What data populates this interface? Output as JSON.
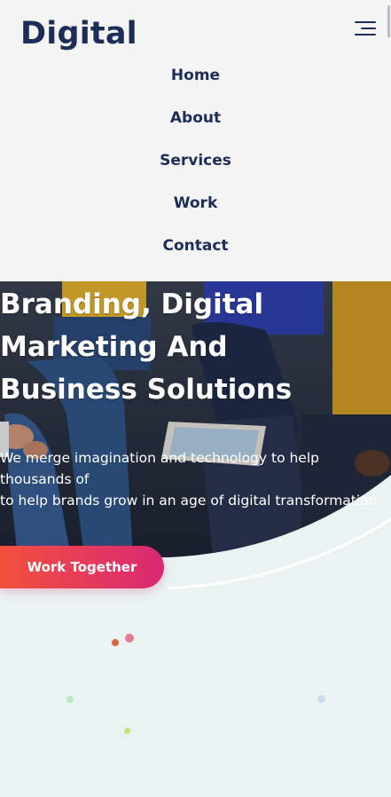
{
  "header": {
    "logo": "Digital",
    "menu_icon": "hamburger-menu-icon"
  },
  "nav": {
    "items": [
      {
        "label": "Home"
      },
      {
        "label": "About"
      },
      {
        "label": "Services"
      },
      {
        "label": "Work"
      },
      {
        "label": "Contact"
      }
    ]
  },
  "hero": {
    "title_lines": [
      "Branding, Digital",
      "Marketing And",
      "Business Solutions"
    ],
    "text_lines": [
      "We merge imagination and technology to help",
      "thousands of",
      "to help brands grow in an age of digital transformation."
    ],
    "cta_label": "Work Together"
  },
  "colors": {
    "brand": "#1b2d58",
    "cta_start": "#f2503d",
    "cta_end": "#d92874",
    "page_bg": "#eaf3f1",
    "header_bg": "#f4f4f4"
  }
}
